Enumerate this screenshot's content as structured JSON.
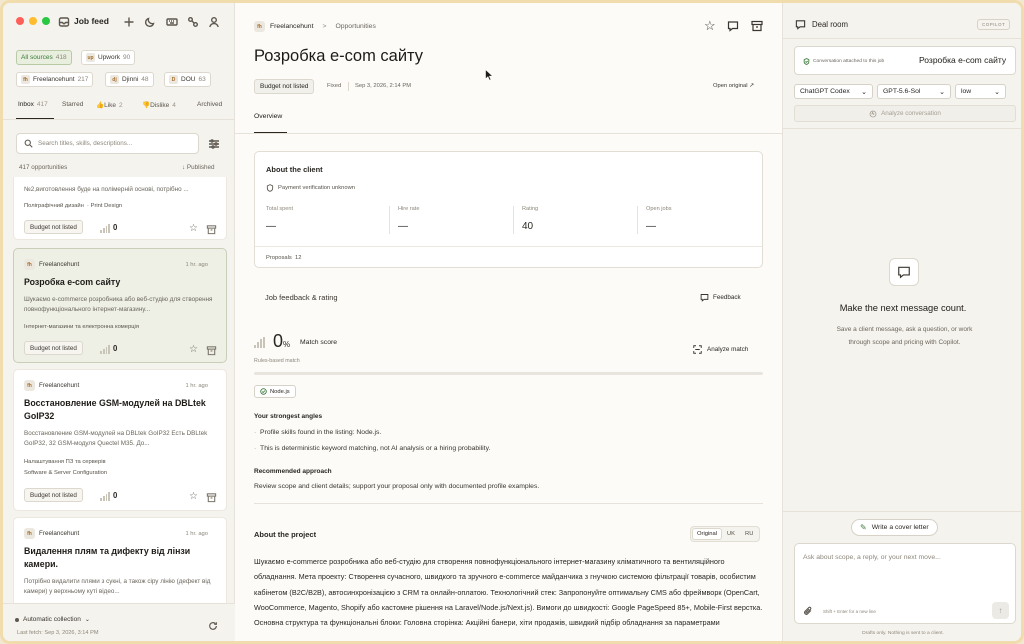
{
  "sidebar": {
    "title": "Job feed",
    "sources": [
      {
        "label": "All sources",
        "count": "418",
        "logo": ""
      },
      {
        "label": "Upwork",
        "count": "90",
        "logo": "up"
      },
      {
        "label": "Freelancehunt",
        "count": "217",
        "logo": "fh"
      },
      {
        "label": "Djinni",
        "count": "48",
        "logo": "dj"
      },
      {
        "label": "DOU",
        "count": "63",
        "logo": "D"
      }
    ],
    "tabs": [
      {
        "label": "Inbox",
        "count": "417"
      },
      {
        "label": "Starred",
        "count": ""
      },
      {
        "label": "Like",
        "count": "2"
      },
      {
        "label": "Dislike",
        "count": "4"
      },
      {
        "label": "Archived",
        "count": ""
      }
    ],
    "search_placeholder": "Search titles, skills, descriptions...",
    "opportunities_count": "417 opportunities",
    "sort_label": "Published",
    "cards": [
      {
        "partial_desc": "№2,виготовлення буде на полімерній основі, потрібно ...",
        "category": "Поліграфічний дизайн",
        "category2": "Print Design",
        "budget": "Budget not listed",
        "score": "0"
      },
      {
        "source": "Freelancehunt",
        "logo": "fh",
        "ago": "1 hr. ago",
        "title": "Розробка e-com сайту",
        "desc": "Шукаємо e-commerce розробника або веб-студію для створення повнофункціонального інтернет-магазину...",
        "category": "Інтернет-магазини та електронна комерція",
        "budget": "Budget not listed",
        "score": "0"
      },
      {
        "source": "Freelancehunt",
        "logo": "fh",
        "ago": "1 hr. ago",
        "title": "Восстановление GSM-модулей на DBLtek GoIP32",
        "desc": "Восстановление GSM-модулей на DBLtek GoIP32 Есть DBLtek GoIP32, 32 GSM-модуля Quectel M35. До...",
        "category": "Налаштування ПЗ та серверів",
        "category2": "Software & Server Configuration",
        "budget": "Budget not listed",
        "score": "0"
      },
      {
        "source": "Freelancehunt",
        "logo": "fh",
        "ago": "1 hr. ago",
        "title": "Видалення плям та дифекту від лінзи камери.",
        "desc": "Потрібно видалити плями з сукні, а також сіру лінію (дефект від камери) у верхньому куті відео..."
      }
    ],
    "footer_mode": "Automatic collection",
    "footer_fetch": "Last fetch: Sep 3, 2026, 3:14 PM"
  },
  "main": {
    "breadcrumb_source": "Freelancehunt",
    "breadcrumb_sep": ">",
    "breadcrumb_page": "Opportunities",
    "title": "Розробка e-com сайту",
    "budget_badge": "Budget not listed",
    "type": "Fixed",
    "date": "Sep 3, 2026, 2:14 PM",
    "open_original": "Open original",
    "tab_overview": "Overview",
    "client": {
      "heading": "About the client",
      "payment": "Payment verification unknown",
      "stats": [
        {
          "label": "Total spent",
          "value": "—"
        },
        {
          "label": "Hire rate",
          "value": "—"
        },
        {
          "label": "Rating",
          "value": "40"
        },
        {
          "label": "Open jobs",
          "value": "—"
        }
      ],
      "proposals_label": "Proposals",
      "proposals_value": "12"
    },
    "feedback_heading": "Job feedback & rating",
    "feedback_button": "Feedback",
    "match_value": "0",
    "match_unit": "%",
    "match_label": "Match score",
    "match_sub": "Rules-based match",
    "analyze_button": "Analyze match",
    "skill_tag": "Node.js",
    "angles_heading": "Your strongest angles",
    "angles": [
      "Profile skills found in the listing: Node.js.",
      "This is deterministic keyword matching, not AI analysis or a hiring probability."
    ],
    "approach_heading": "Recommended approach",
    "approach_text": "Review scope and client details; support your proposal only with documented profile examples.",
    "project_heading": "About the project",
    "lang_tabs": [
      "Original",
      "UK",
      "RU"
    ],
    "project_text": "Шукаємо e-commerce розробника або веб-студію для створення повнофункціонального інтернет-магазину кліматичного та вентиляційного обладнання. Мета проекту: Створення сучасного, швидкого та зручного e-commerce майданчика з гнучкою системою фільтрації товарів, особистим кабінетом (B2C/B2B), автосинхронізацією з CRM та онлайн-оплатою. Технологічний стек: Запропонуйте оптимальну CMS або фреймворк (OpenCart, WooCommerce, Magento, Shopify або кастомне рішення на Laravel/Node.js/Next.js). Вимоги до швидкості: Google PageSpeed 85+, Mobile-First верстка. Основна структура та функціональні блоки: Головна сторінка: Акційні банери, хіти продажів, швидкий підбір обладнання за параметрами"
  },
  "deal": {
    "title": "Deal room",
    "badge": "COPILOT",
    "attached_label": "Conversation attached to this job",
    "attached_title": "Розробка e-com сайту",
    "model1": "ChatGPT Codex",
    "model2": "GPT-5.6-Sol",
    "effort": "low",
    "analyze": "Analyze conversation",
    "empty_title": "Make the next message count.",
    "empty_text": "Save a client message, ask a question, or work through scope and pricing with Copilot.",
    "cover_button": "Write a cover letter",
    "input_placeholder": "Ask about scope, a reply, or your next move...",
    "hint": "Shift + Enter for a new line",
    "footer": "Drafts only. Nothing is sent to a client."
  },
  "colors": {
    "accent": "#3c7a3a",
    "selected_card": "#eef0e6",
    "frame": "#f0dcad"
  }
}
